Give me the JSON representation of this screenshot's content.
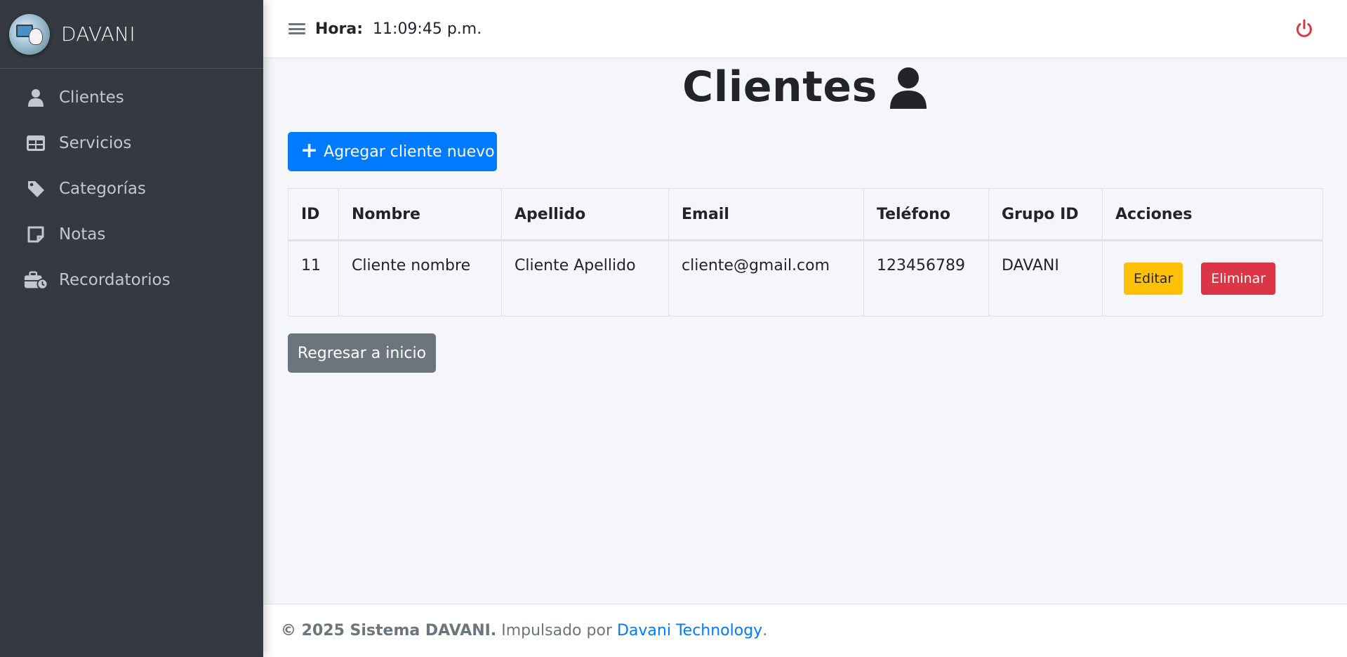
{
  "brand": {
    "name": "DAVANI"
  },
  "sidebar": {
    "items": [
      {
        "label": "Clientes",
        "icon": "user-icon"
      },
      {
        "label": "Servicios",
        "icon": "table-icon"
      },
      {
        "label": "Categorías",
        "icon": "tag-icon"
      },
      {
        "label": "Notas",
        "icon": "sticky-note-icon"
      },
      {
        "label": "Recordatorios",
        "icon": "briefcase-clock-icon"
      }
    ]
  },
  "header": {
    "hora_label": "Hora:",
    "hora_value": "11:09:45 p.m.",
    "power_color": "#dc3545"
  },
  "main": {
    "title": "Clientes",
    "add_button": {
      "plus": "+",
      "label": "Agregar cliente nuevo"
    },
    "table": {
      "headers": [
        "ID",
        "Nombre",
        "Apellido",
        "Email",
        "Teléfono",
        "Grupo ID",
        "Acciones"
      ],
      "rows": [
        {
          "id": "11",
          "nombre": "Cliente nombre",
          "apellido": "Cliente Apellido",
          "email": "cliente@gmail.com",
          "telefono": "123456789",
          "grupo": "DAVANI",
          "edit_label": "Editar",
          "delete_label": "Eliminar"
        }
      ]
    },
    "back_button": "Regresar a inicio"
  },
  "footer": {
    "copyright": "© 2025 Sistema DAVANI.",
    "powered": " Impulsado por ",
    "link": "Davani Technology",
    "end": "."
  },
  "colors": {
    "sidebar_bg": "#343a40",
    "primary": "#007bff",
    "warning": "#ffc107",
    "danger": "#dc3545",
    "secondary": "#6c757d"
  }
}
